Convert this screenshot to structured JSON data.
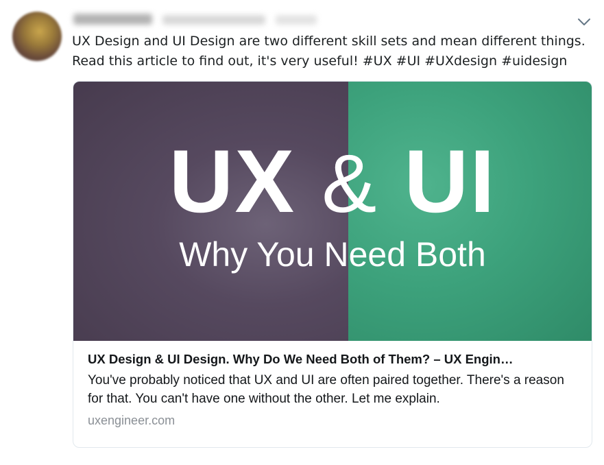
{
  "tweet": {
    "text_line1": "UX Design and UI Design are two different skill sets and mean different things.",
    "text_line2_prefix": "Read this article to find out, it's very useful! ",
    "hashtags": [
      "#UX",
      "#UI",
      "#UXdesign",
      "#uidesign"
    ]
  },
  "card": {
    "image": {
      "headline_left": "UX",
      "headline_amp": "&",
      "headline_right": "UI",
      "subheadline": "Why You Need Both",
      "left_color": "#4f4356",
      "right_color": "#3da27c"
    },
    "title": "UX Design & UI Design. Why Do We Need Both of Them? – UX Engin…",
    "description": "You've probably noticed that UX and UI are often paired together. There's a reason for that. You can't have one without the other. Let me explain.",
    "domain": "uxengineer.com"
  },
  "icons": {
    "menu": "chevron-down-icon"
  }
}
